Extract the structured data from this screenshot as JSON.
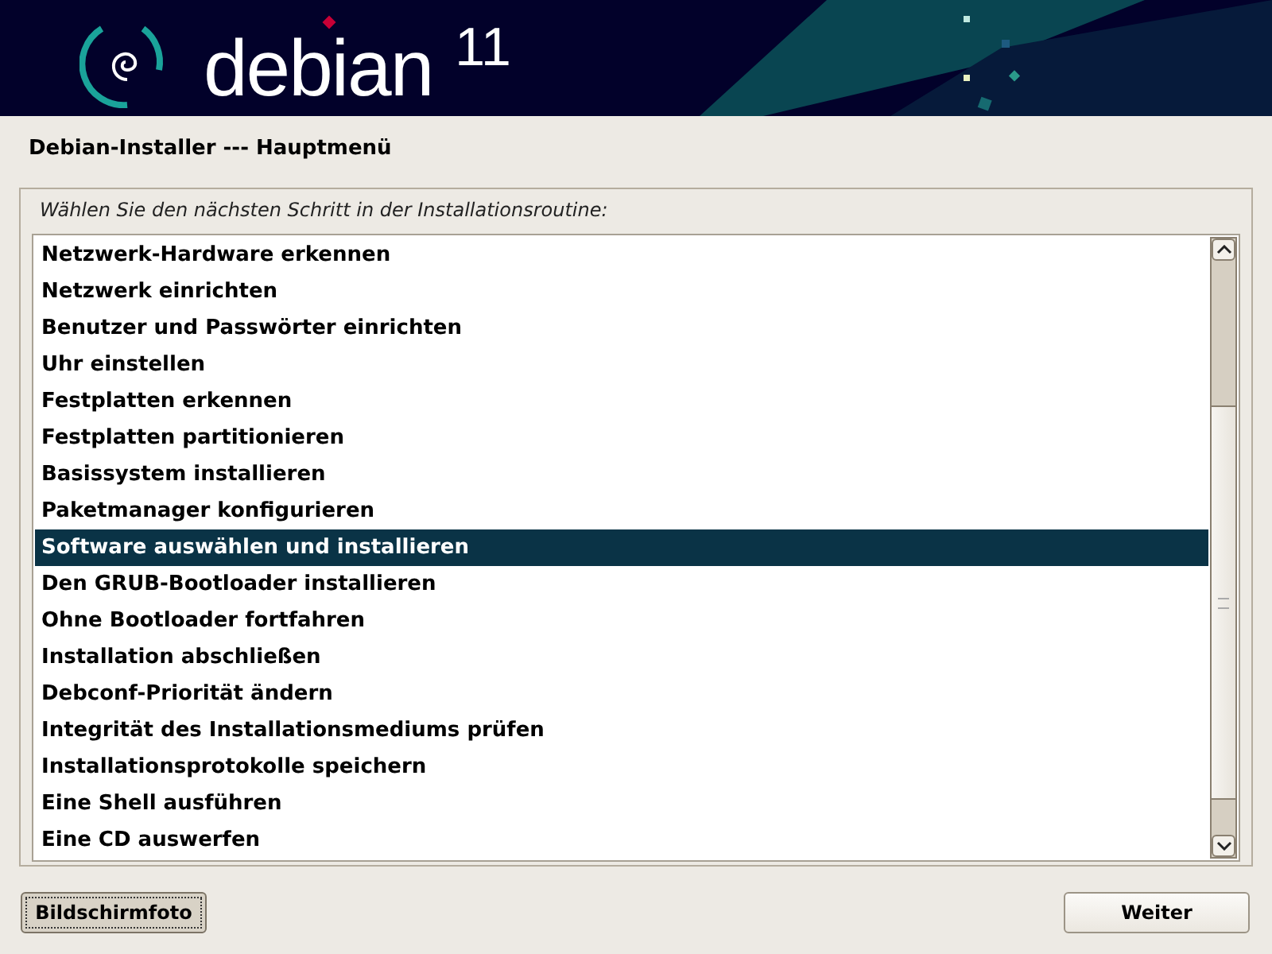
{
  "banner": {
    "logo_text": "debian",
    "version": "11"
  },
  "window": {
    "title": "Debian-Installer --- Hauptmenü"
  },
  "prompt": "Wählen Sie den nächsten Schritt in der Installationsroutine:",
  "menu_items": [
    {
      "label": "Netzwerk-Hardware erkennen",
      "selected": false
    },
    {
      "label": "Netzwerk einrichten",
      "selected": false
    },
    {
      "label": "Benutzer und Passwörter einrichten",
      "selected": false
    },
    {
      "label": "Uhr einstellen",
      "selected": false
    },
    {
      "label": "Festplatten erkennen",
      "selected": false
    },
    {
      "label": "Festplatten partitionieren",
      "selected": false
    },
    {
      "label": "Basissystem installieren",
      "selected": false
    },
    {
      "label": "Paketmanager konfigurieren",
      "selected": false
    },
    {
      "label": "Software auswählen und installieren",
      "selected": true
    },
    {
      "label": "Den GRUB-Bootloader installieren",
      "selected": false
    },
    {
      "label": "Ohne Bootloader fortfahren",
      "selected": false
    },
    {
      "label": "Installation abschließen",
      "selected": false
    },
    {
      "label": "Debconf-Priorität ändern",
      "selected": false
    },
    {
      "label": "Integrität des Installationsmediums prüfen",
      "selected": false
    },
    {
      "label": "Installationsprotokolle speichern",
      "selected": false
    },
    {
      "label": "Eine Shell ausführen",
      "selected": false
    },
    {
      "label": "Eine CD auswerfen",
      "selected": false
    }
  ],
  "buttons": [
    {
      "label": "Bildschirmfoto",
      "kind": "pressed"
    },
    {
      "label": "Weiter",
      "kind": "normal"
    }
  ]
}
